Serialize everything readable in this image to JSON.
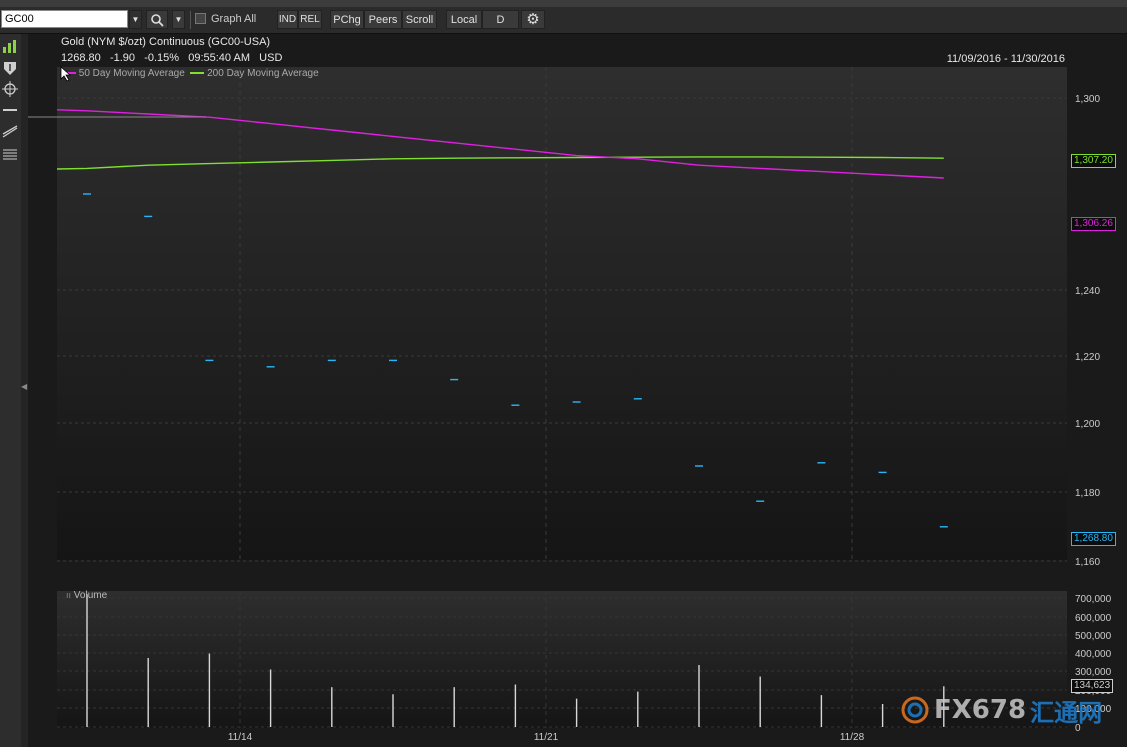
{
  "toolbar": {
    "symbol_value": "GC00",
    "graph_all_label": "Graph All",
    "ind_label": "IND",
    "rel_label": "REL",
    "pchg_label": "PChg",
    "peers_label": "Peers",
    "scroll_label": "Scroll",
    "local_label": "Local",
    "period_label": "D"
  },
  "header": {
    "title": "Gold (NYM $/ozt) Continuous (GC00-USA)",
    "last": "1268.80",
    "change": "-1.90",
    "pct_change": "-0.15%",
    "time": "09:55:40 AM",
    "currency": "USD",
    "date_range": "11/09/2016 - 11/30/2016"
  },
  "legend": {
    "ma50": "50 Day Moving Average",
    "ma200": "200 Day Moving Average"
  },
  "badges": {
    "ma200_value": "1,307.20",
    "ma50_value": "1,306.26",
    "last_value": "1,268.80",
    "volume_value": "134,623"
  },
  "volume_panel": {
    "label": "Volume"
  },
  "colors": {
    "price": "#29b6f6",
    "ma50": "#e020e0",
    "ma200": "#7fe030",
    "volume": "#d8d8d8",
    "volume_badge": "#cccccc"
  },
  "watermark": {
    "text": "FX678",
    "cn": "汇通网"
  },
  "chart_data": [
    {
      "type": "line",
      "title": "Gold (NYM $/ozt) Continuous (GC00-USA)",
      "y_tick_labels": [
        "1,300",
        "1,240",
        "1,220",
        "1,200",
        "1,180",
        "1,160"
      ],
      "x_tick_labels": [
        "11/14",
        "11/21",
        "11/28"
      ],
      "series": [
        {
          "name": "Price",
          "style": "close-dash",
          "values": [
            1270,
            1263,
            1218,
            1216,
            1218,
            1218,
            1212,
            1204,
            1205,
            1206,
            1185,
            1174,
            1186,
            1183,
            1166
          ]
        },
        {
          "name": "50 Day Moving Average",
          "values": [
            1296,
            1295,
            1294,
            1292,
            1290,
            1288,
            1286,
            1284,
            1282,
            1281,
            1279,
            1278,
            1277,
            1276,
            1275
          ]
        },
        {
          "name": "200 Day Moving Average",
          "values": [
            1278,
            1279,
            1279.5,
            1280,
            1280.5,
            1281,
            1281.2,
            1281.3,
            1281.4,
            1281.5,
            1281.6,
            1281.6,
            1281.5,
            1281.4,
            1281.2
          ]
        }
      ],
      "grid": true
    },
    {
      "type": "bar",
      "title": "Volume",
      "y_tick_labels": [
        "700,000",
        "600,000",
        "500,000",
        "400,000",
        "300,000",
        "200,000",
        "100,000",
        "0"
      ],
      "ylim": [
        0,
        700000
      ],
      "values": [
        750000,
        390000,
        415000,
        325000,
        225000,
        185000,
        225000,
        240000,
        160000,
        200000,
        350000,
        285000,
        180000,
        130000,
        230000
      ]
    }
  ]
}
